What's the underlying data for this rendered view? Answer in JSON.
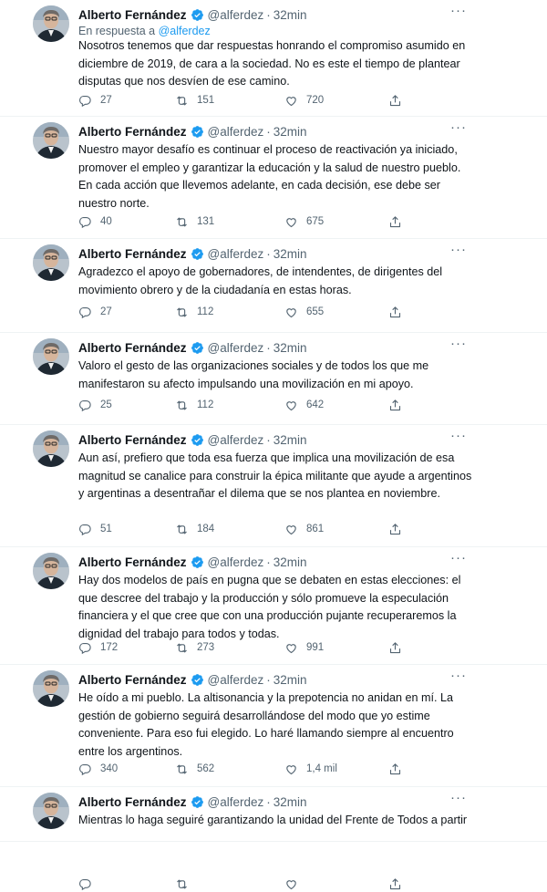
{
  "author": {
    "name": "Alberto Fernández",
    "handle": "@alferdez",
    "separator": "·",
    "time": "32min"
  },
  "more_label": "···",
  "tweets": [
    {
      "reply_prefix": "En respuesta a",
      "reply_handle": "@alferdez",
      "text": "Nosotros tenemos que dar respuestas honrando el compromiso asumido en diciembre de 2019, de cara a la sociedad. No es este el tiempo de plantear disputas que nos desvíen de ese camino.",
      "replies": "27",
      "retweets": "151",
      "likes": "720"
    },
    {
      "text": "Nuestro mayor desafío es continuar el proceso de reactivación ya iniciado, promover el empleo y garantizar la educación y la salud de nuestro pueblo. En cada acción que llevemos adelante, en cada decisión, ese debe ser nuestro norte.",
      "replies": "40",
      "retweets": "131",
      "likes": "675"
    },
    {
      "text": "Agradezco el apoyo de gobernadores, de intendentes, de dirigentes del movimiento obrero y de la ciudadanía en estas horas.",
      "replies": "27",
      "retweets": "112",
      "likes": "655"
    },
    {
      "text": "Valoro el gesto de las organizaciones sociales y de todos los que me manifestaron su afecto impulsando una movilización en mi apoyo.",
      "replies": "25",
      "retweets": "112",
      "likes": "642"
    },
    {
      "text": "Aun así, prefiero que toda esa fuerza que implica una movilización de esa magnitud se canalice para construir la épica militante que ayude a argentinos y argentinas a desentrañar el dilema que se nos plantea en noviembre.",
      "replies": "51",
      "retweets": "184",
      "likes": "861"
    },
    {
      "text": "Hay dos modelos de país en pugna que se debaten en estas elecciones: el que descree del trabajo y la producción y sólo promueve la especulación financiera y el que cree que con una producción pujante recuperaremos la dignidad del trabajo para todos y todas.",
      "replies": "172",
      "retweets": "273",
      "likes": "991"
    },
    {
      "text": "He oído a mi pueblo. La altisonancia y la prepotencia no anidan en mí. La gestión de gobierno seguirá desarrollándose del modo que yo estime conveniente. Para eso fui elegido. Lo haré llamando siempre al encuentro entre los argentinos.",
      "replies": "340",
      "retweets": "562",
      "likes": "1,4 mil"
    },
    {
      "text": "Mientras lo haga seguiré garantizando la unidad del Frente de Todos a partir",
      "replies": "",
      "retweets": "",
      "likes": ""
    }
  ]
}
